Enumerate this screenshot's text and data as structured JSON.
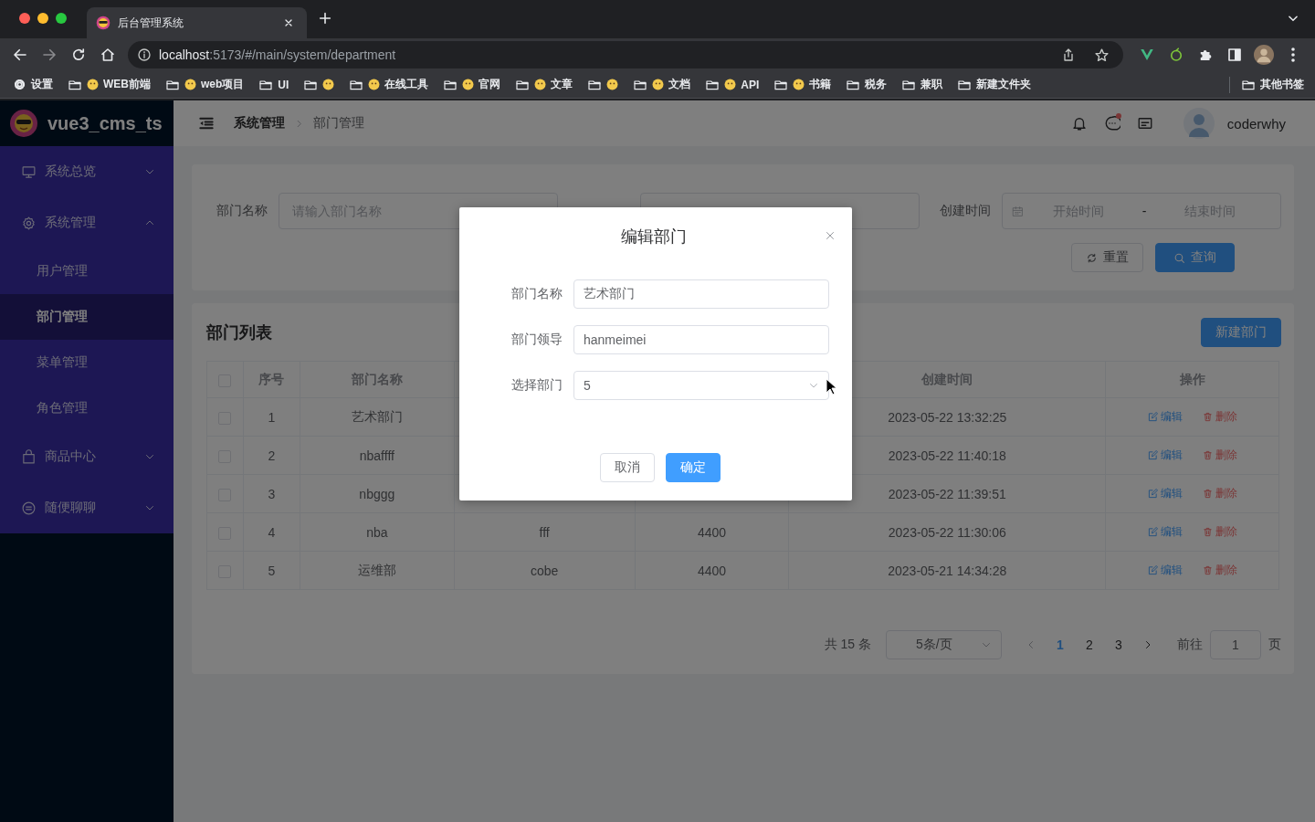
{
  "browser": {
    "tab_title": "后台管理系统",
    "url_host": "localhost",
    "url_rest": ":5173/#/main/system/department",
    "bookmarks": [
      {
        "kind": "settings",
        "label": "设置"
      },
      {
        "kind": "folder",
        "emoji": true,
        "label": "WEB前端"
      },
      {
        "kind": "folder",
        "emoji": true,
        "label": "web项目"
      },
      {
        "kind": "folder",
        "emoji": false,
        "label": "UI"
      },
      {
        "kind": "folder",
        "emoji": true
      },
      {
        "kind": "folder",
        "emoji": true,
        "label": "在线工具"
      },
      {
        "kind": "folder",
        "emoji": true,
        "label": "官网"
      },
      {
        "kind": "folder",
        "emoji": true,
        "label": "文章"
      },
      {
        "kind": "folder",
        "emoji": true
      },
      {
        "kind": "folder",
        "emoji": true,
        "label": "文档"
      },
      {
        "kind": "folder",
        "emoji": true,
        "label": "API"
      },
      {
        "kind": "folder",
        "emoji": true,
        "label": "书籍"
      },
      {
        "kind": "folder",
        "emoji": false,
        "label": "税务"
      },
      {
        "kind": "folder",
        "emoji": false,
        "label": "兼职"
      },
      {
        "kind": "folder",
        "emoji": false,
        "label": "新建文件夹"
      }
    ],
    "other_bookmarks": "其他书签"
  },
  "sidebar": {
    "logo_text": "vue3_cms_ts",
    "menu": [
      {
        "kind": "monitor",
        "label": "系统总览",
        "expanded": false
      },
      {
        "kind": "gear",
        "label": "系统管理",
        "expanded": true,
        "children": [
          {
            "label": "用户管理",
            "selected": false
          },
          {
            "label": "部门管理",
            "selected": true
          },
          {
            "label": "菜单管理",
            "selected": false
          },
          {
            "label": "角色管理",
            "selected": false
          }
        ]
      },
      {
        "kind": "bag",
        "label": "商品中心",
        "expanded": false
      },
      {
        "kind": "chat",
        "label": "随便聊聊",
        "expanded": false
      }
    ]
  },
  "header": {
    "breadcrumb": [
      "系统管理",
      "部门管理"
    ],
    "unread_messages": true,
    "username": "coderwhy"
  },
  "search": {
    "fields": [
      {
        "kind": "text",
        "label": "部门名称",
        "placeholder": "请输入部门名称"
      },
      {
        "kind": "text"
      },
      {
        "kind": "date-range",
        "label": "创建时间",
        "start_placeholder": "开始时间",
        "separator": "-",
        "end_placeholder": "结束时间"
      }
    ],
    "buttons": [
      {
        "kind": "reset",
        "label": "重置"
      },
      {
        "kind": "search",
        "label": "查询"
      }
    ]
  },
  "table": {
    "title": "部门列表",
    "create_button": "新建部门",
    "all_checked": false,
    "columns": [
      "序号",
      "部门名称",
      null,
      null,
      "创建时间",
      "操作"
    ],
    "rows": [
      {
        "checked": false,
        "cells": [
          "1",
          "艺术部门",
          null,
          null,
          "2023-05-22 13:32:25"
        ],
        "edit": "编辑",
        "delete": "删除"
      },
      {
        "checked": false,
        "cells": [
          "2",
          "nbaffff",
          null,
          null,
          "2023-05-22 11:40:18"
        ],
        "edit": "编辑",
        "delete": "删除"
      },
      {
        "checked": false,
        "cells": [
          "3",
          "nbggg",
          null,
          null,
          "2023-05-22 11:39:51"
        ],
        "edit": "编辑",
        "delete": "删除"
      },
      {
        "checked": false,
        "cells": [
          "4",
          "nba",
          "fff",
          "4400",
          "2023-05-22 11:30:06"
        ],
        "edit": "编辑",
        "delete": "删除"
      },
      {
        "checked": false,
        "cells": [
          "5",
          "运维部",
          "cobe",
          "4400",
          "2023-05-21 14:34:28"
        ],
        "edit": "编辑",
        "delete": "删除"
      }
    ]
  },
  "pagination": {
    "total": "共 15 条",
    "page_size": "5条/页",
    "pages": [
      {
        "label": "1",
        "selected": true
      },
      {
        "label": "2",
        "selected": false
      },
      {
        "label": "3",
        "selected": false
      }
    ],
    "goto_label": "前往",
    "goto_value": "1",
    "goto_suffix": "页"
  },
  "dialog": {
    "title": "编辑部门",
    "fields": [
      {
        "kind": "input",
        "label": "部门名称",
        "value": "艺术部门"
      },
      {
        "kind": "input",
        "label": "部门领导",
        "value": "hanmeimei"
      },
      {
        "kind": "select",
        "label": "选择部门",
        "value": "5"
      }
    ],
    "buttons": [
      {
        "kind": "cancel",
        "label": "取消"
      },
      {
        "kind": "confirm",
        "label": "确定"
      }
    ]
  }
}
